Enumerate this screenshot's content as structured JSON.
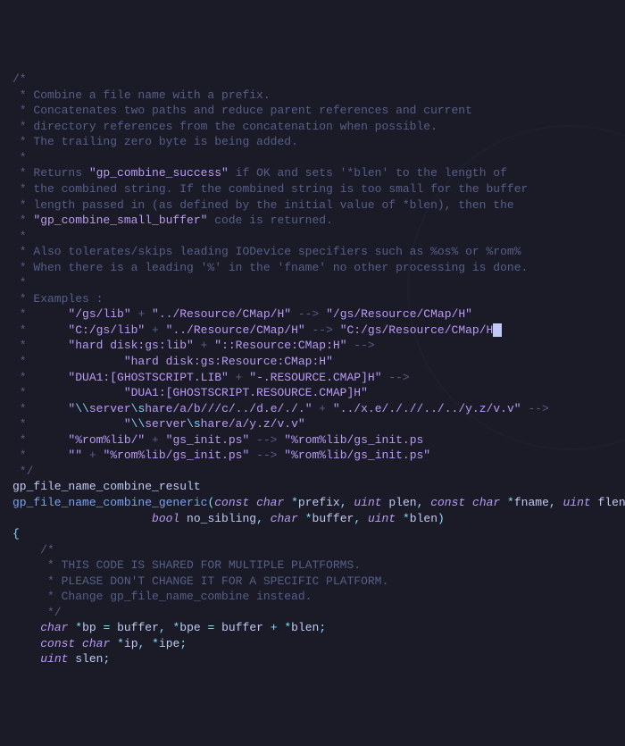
{
  "code": {
    "lines": [
      {
        "cls": "c-comment",
        "text": "/*"
      },
      {
        "cls": "c-comment",
        "text": " * Combine a file name with a prefix."
      },
      {
        "cls": "c-comment",
        "text": " * Concatenates two paths and reduce parent references and current"
      },
      {
        "cls": "c-comment",
        "text": " * directory references from the concatenation when possible."
      },
      {
        "cls": "c-comment",
        "text": " * The trailing zero byte is being added."
      },
      {
        "cls": "c-comment",
        "text": " *"
      },
      {
        "cls": "mixed",
        "segments": [
          {
            "cls": "c-comment",
            "text": " * Returns "
          },
          {
            "cls": "c-hl",
            "text": "\"gp_combine_success\""
          },
          {
            "cls": "c-comment",
            "text": " if OK and sets '*blen' to the length of"
          }
        ]
      },
      {
        "cls": "c-comment",
        "text": " * the combined string. If the combined string is too small for the buffer"
      },
      {
        "cls": "c-comment",
        "text": " * length passed in (as defined by the initial value of *blen), then the"
      },
      {
        "cls": "mixed",
        "segments": [
          {
            "cls": "c-comment",
            "text": " * "
          },
          {
            "cls": "c-hl",
            "text": "\"gp_combine_small_buffer\""
          },
          {
            "cls": "c-comment",
            "text": " code is returned."
          }
        ]
      },
      {
        "cls": "c-comment",
        "text": " *"
      },
      {
        "cls": "c-comment",
        "text": " * Also tolerates/skips leading IODevice specifiers such as %os% or %rom%"
      },
      {
        "cls": "c-comment",
        "text": " * When there is a leading '%' in the 'fname' no other processing is done."
      },
      {
        "cls": "c-comment",
        "text": " *"
      },
      {
        "cls": "c-comment",
        "text": " * Examples :"
      },
      {
        "cls": "mixed",
        "segments": [
          {
            "cls": "c-comment",
            "text": " *      "
          },
          {
            "cls": "c-hl",
            "text": "\"/gs/lib\""
          },
          {
            "cls": "c-comment",
            "text": " + "
          },
          {
            "cls": "c-hl",
            "text": "\"../Resource/CMap/H\""
          },
          {
            "cls": "c-comment",
            "text": " --> "
          },
          {
            "cls": "c-hl",
            "text": "\"/gs/Resource/CMap/H\""
          }
        ]
      },
      {
        "cls": "mixed",
        "segments": [
          {
            "cls": "c-comment",
            "text": " *      "
          },
          {
            "cls": "c-hl",
            "text": "\"C:/gs/lib\""
          },
          {
            "cls": "c-comment",
            "text": " + "
          },
          {
            "cls": "c-hl",
            "text": "\"../Resource/CMap/H\""
          },
          {
            "cls": "c-comment",
            "text": " --> "
          },
          {
            "cls": "c-hl",
            "text": "\"C:/gs/Resource/CMap/H"
          },
          {
            "cls": "cursor",
            "text": " "
          }
        ]
      },
      {
        "cls": "mixed",
        "segments": [
          {
            "cls": "c-comment",
            "text": " *      "
          },
          {
            "cls": "c-hl",
            "text": "\"hard disk:gs:lib\""
          },
          {
            "cls": "c-comment",
            "text": " + "
          },
          {
            "cls": "c-hl",
            "text": "\"::Resource:CMap:H\""
          },
          {
            "cls": "c-comment",
            "text": " -->"
          }
        ]
      },
      {
        "cls": "mixed",
        "segments": [
          {
            "cls": "c-comment",
            "text": " *              "
          },
          {
            "cls": "c-hl",
            "text": "\"hard disk:gs:Resource:CMap:H\""
          }
        ]
      },
      {
        "cls": "mixed",
        "segments": [
          {
            "cls": "c-comment",
            "text": " *      "
          },
          {
            "cls": "c-hl",
            "text": "\"DUA1:[GHOSTSCRIPT.LIB\""
          },
          {
            "cls": "c-comment",
            "text": " + "
          },
          {
            "cls": "c-hl",
            "text": "\"-.RESOURCE.CMAP]H\""
          },
          {
            "cls": "c-comment",
            "text": " -->"
          }
        ]
      },
      {
        "cls": "mixed",
        "segments": [
          {
            "cls": "c-comment",
            "text": " *              "
          },
          {
            "cls": "c-hl",
            "text": "\"DUA1:[GHOSTSCRIPT.RESOURCE.CMAP]H\""
          }
        ]
      },
      {
        "cls": "mixed",
        "segments": [
          {
            "cls": "c-comment",
            "text": " *      "
          },
          {
            "cls": "c-hl",
            "text": "\""
          },
          {
            "cls": "c-esc",
            "text": "\\\\"
          },
          {
            "cls": "c-hl",
            "text": "server"
          },
          {
            "cls": "c-esc",
            "text": "\\s"
          },
          {
            "cls": "c-hl",
            "text": "hare/a/b///c/../d.e/./.\""
          },
          {
            "cls": "c-comment",
            "text": " + "
          },
          {
            "cls": "c-hl",
            "text": "\"../x.e/././/../../y.z/v.v\""
          },
          {
            "cls": "c-comment",
            "text": " -->"
          }
        ]
      },
      {
        "cls": "mixed",
        "segments": [
          {
            "cls": "c-comment",
            "text": " *              "
          },
          {
            "cls": "c-hl",
            "text": "\""
          },
          {
            "cls": "c-esc",
            "text": "\\\\"
          },
          {
            "cls": "c-hl",
            "text": "server"
          },
          {
            "cls": "c-esc",
            "text": "\\s"
          },
          {
            "cls": "c-hl",
            "text": "hare/a/y.z/v.v\""
          }
        ]
      },
      {
        "cls": "mixed",
        "segments": [
          {
            "cls": "c-comment",
            "text": " *      "
          },
          {
            "cls": "c-hl",
            "text": "\"%rom%lib/\""
          },
          {
            "cls": "c-comment",
            "text": " + "
          },
          {
            "cls": "c-hl",
            "text": "\"gs_init.ps\""
          },
          {
            "cls": "c-comment",
            "text": " --> "
          },
          {
            "cls": "c-hl",
            "text": "\"%rom%lib/gs_init.ps"
          }
        ]
      },
      {
        "cls": "mixed",
        "segments": [
          {
            "cls": "c-comment",
            "text": " *      "
          },
          {
            "cls": "c-hl",
            "text": "\"\""
          },
          {
            "cls": "c-comment",
            "text": " + "
          },
          {
            "cls": "c-hl",
            "text": "\"%rom%lib/gs_init.ps\""
          },
          {
            "cls": "c-comment",
            "text": " --> "
          },
          {
            "cls": "c-hl",
            "text": "\"%rom%lib/gs_init.ps\""
          }
        ]
      },
      {
        "cls": "c-comment",
        "text": " */"
      },
      {
        "cls": "c-ident",
        "text": "gp_file_name_combine_result"
      },
      {
        "cls": "mixed",
        "segments": [
          {
            "cls": "c-func",
            "text": "gp_file_name_combine_generic"
          },
          {
            "cls": "c-punct",
            "text": "("
          },
          {
            "cls": "c-keyword",
            "text": "const"
          },
          {
            "cls": "c-ident",
            "text": " "
          },
          {
            "cls": "c-type",
            "text": "char"
          },
          {
            "cls": "c-ident",
            "text": " "
          },
          {
            "cls": "c-punct",
            "text": "*"
          },
          {
            "cls": "c-ident",
            "text": "prefix"
          },
          {
            "cls": "c-punct",
            "text": ", "
          },
          {
            "cls": "c-type",
            "text": "uint"
          },
          {
            "cls": "c-ident",
            "text": " plen"
          },
          {
            "cls": "c-punct",
            "text": ", "
          },
          {
            "cls": "c-keyword",
            "text": "const"
          },
          {
            "cls": "c-ident",
            "text": " "
          },
          {
            "cls": "c-type",
            "text": "char"
          },
          {
            "cls": "c-ident",
            "text": " "
          },
          {
            "cls": "c-punct",
            "text": "*"
          },
          {
            "cls": "c-ident",
            "text": "fname"
          },
          {
            "cls": "c-punct",
            "text": ", "
          },
          {
            "cls": "c-type",
            "text": "uint"
          },
          {
            "cls": "c-ident",
            "text": " flen"
          },
          {
            "cls": "c-punct",
            "text": ","
          }
        ]
      },
      {
        "cls": "mixed",
        "segments": [
          {
            "cls": "c-ident",
            "text": "                    "
          },
          {
            "cls": "c-type",
            "text": "bool"
          },
          {
            "cls": "c-ident",
            "text": " no_sibling"
          },
          {
            "cls": "c-punct",
            "text": ", "
          },
          {
            "cls": "c-type",
            "text": "char"
          },
          {
            "cls": "c-ident",
            "text": " "
          },
          {
            "cls": "c-punct",
            "text": "*"
          },
          {
            "cls": "c-ident",
            "text": "buffer"
          },
          {
            "cls": "c-punct",
            "text": ", "
          },
          {
            "cls": "c-type",
            "text": "uint"
          },
          {
            "cls": "c-ident",
            "text": " "
          },
          {
            "cls": "c-punct",
            "text": "*"
          },
          {
            "cls": "c-ident",
            "text": "blen"
          },
          {
            "cls": "c-punct",
            "text": ")"
          }
        ]
      },
      {
        "cls": "c-punct",
        "text": "{"
      },
      {
        "cls": "c-comment",
        "text": "    /*"
      },
      {
        "cls": "c-comment",
        "text": "     * THIS CODE IS SHARED FOR MULTIPLE PLATFORMS."
      },
      {
        "cls": "c-comment",
        "text": "     * PLEASE DON'T CHANGE IT FOR A SPECIFIC PLATFORM."
      },
      {
        "cls": "c-comment",
        "text": "     * Change gp_file_name_combine instead."
      },
      {
        "cls": "c-comment",
        "text": "     */"
      },
      {
        "cls": "mixed",
        "segments": [
          {
            "cls": "c-ident",
            "text": "    "
          },
          {
            "cls": "c-type",
            "text": "char"
          },
          {
            "cls": "c-ident",
            "text": " "
          },
          {
            "cls": "c-punct",
            "text": "*"
          },
          {
            "cls": "c-ident",
            "text": "bp "
          },
          {
            "cls": "c-punct",
            "text": "= "
          },
          {
            "cls": "c-ident",
            "text": "buffer"
          },
          {
            "cls": "c-punct",
            "text": ", *"
          },
          {
            "cls": "c-ident",
            "text": "bpe "
          },
          {
            "cls": "c-punct",
            "text": "= "
          },
          {
            "cls": "c-ident",
            "text": "buffer "
          },
          {
            "cls": "c-punct",
            "text": "+ *"
          },
          {
            "cls": "c-ident",
            "text": "blen"
          },
          {
            "cls": "c-punct",
            "text": ";"
          }
        ]
      },
      {
        "cls": "mixed",
        "segments": [
          {
            "cls": "c-ident",
            "text": "    "
          },
          {
            "cls": "c-keyword",
            "text": "const"
          },
          {
            "cls": "c-ident",
            "text": " "
          },
          {
            "cls": "c-type",
            "text": "char"
          },
          {
            "cls": "c-ident",
            "text": " "
          },
          {
            "cls": "c-punct",
            "text": "*"
          },
          {
            "cls": "c-ident",
            "text": "ip"
          },
          {
            "cls": "c-punct",
            "text": ", *"
          },
          {
            "cls": "c-ident",
            "text": "ipe"
          },
          {
            "cls": "c-punct",
            "text": ";"
          }
        ]
      },
      {
        "cls": "mixed",
        "segments": [
          {
            "cls": "c-ident",
            "text": "    "
          },
          {
            "cls": "c-type",
            "text": "uint"
          },
          {
            "cls": "c-ident",
            "text": " slen"
          },
          {
            "cls": "c-punct",
            "text": ";"
          }
        ]
      }
    ]
  }
}
